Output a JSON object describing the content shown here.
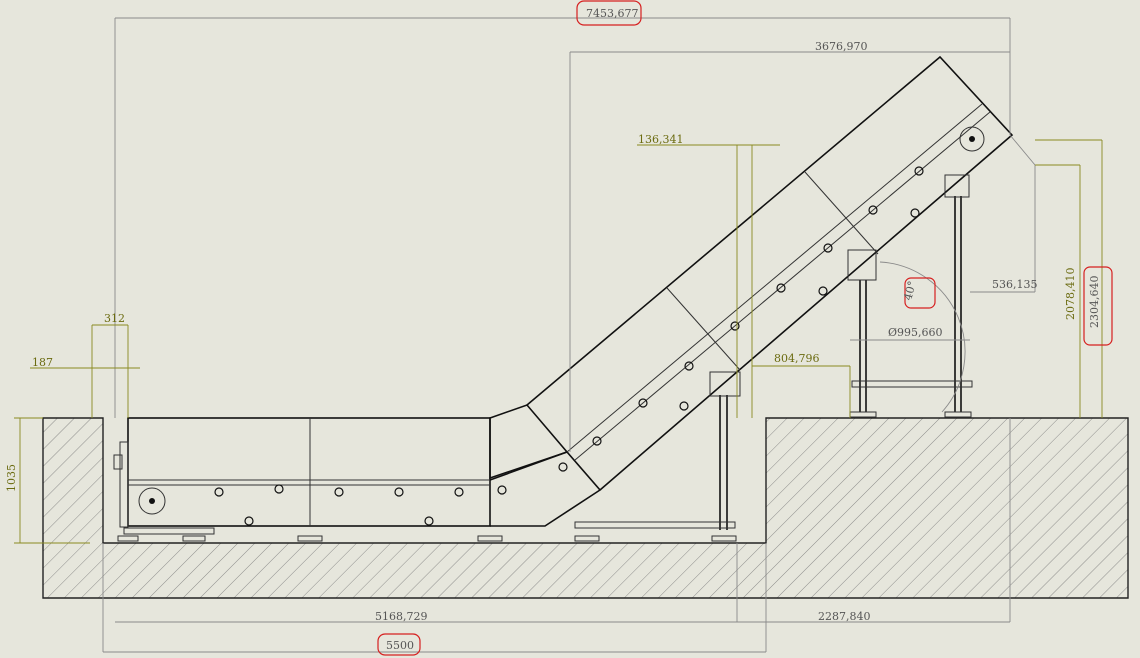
{
  "colors": {
    "background": "#e6e6dc",
    "outline": "#111111",
    "dimension_dark": "#555555",
    "dimension_olive": "#6b6b10",
    "highlight": "#d62020"
  },
  "dimensions": {
    "overall_length": "7453,677",
    "incline_horizontal": "3676,970",
    "top_offset": "136,341",
    "support_offset": "804,796",
    "pit_to_rear": "536,135",
    "drum_diameter": "Ø995,660",
    "incline_angle": "40°",
    "height_inner": "2078,410",
    "height_total": "2304,640",
    "left_small": "312",
    "left_offset": "187",
    "pit_depth": "1035",
    "horizontal_length": "5168,729",
    "incline_base": "2287,840",
    "pit_length": "5500"
  }
}
